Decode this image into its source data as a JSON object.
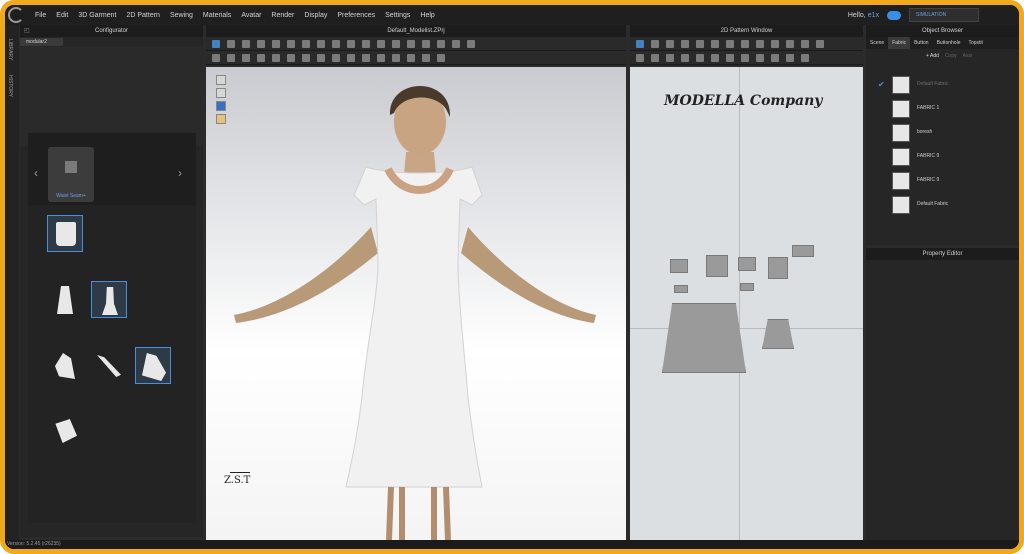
{
  "menubar": {
    "items": [
      "File",
      "Edit",
      "3D Garment",
      "2D Pattern",
      "Sewing",
      "Materials",
      "Avatar",
      "Render",
      "Display",
      "Preferences",
      "Settings",
      "Help"
    ],
    "greeting_prefix": "Hello,",
    "username": "e1x",
    "mode": "SIMULATION"
  },
  "left_strip": {
    "labels": [
      "LIBRARY",
      "HISTORY"
    ]
  },
  "configurator": {
    "title": "Configurator",
    "tab": "modular2",
    "block_label": "Waist Seam+"
  },
  "viewport": {
    "title": "Default_Modelist.ZPrj",
    "watermark": "Z.S.T"
  },
  "pattern_window": {
    "title": "2D Pattern Window",
    "company": "MODELLA Company"
  },
  "object_browser": {
    "title": "Object Browser",
    "tabs": [
      "Scene",
      "Fabric",
      "Button",
      "Buttonhole",
      "Topstit"
    ],
    "actions": {
      "add": "+ Add",
      "copy": "Copy",
      "assign": "Assi"
    },
    "fabrics": [
      {
        "name": "Default Fabric",
        "muted": true,
        "checked": true
      },
      {
        "name": "FABRIC 1",
        "muted": false,
        "checked": false
      },
      {
        "name": "boresh",
        "muted": false,
        "checked": false
      },
      {
        "name": "FABRIC 9",
        "muted": false,
        "checked": false
      },
      {
        "name": "FABRIC 9",
        "muted": false,
        "checked": false
      },
      {
        "name": "Default Fabric",
        "muted": false,
        "checked": false
      }
    ]
  },
  "property_editor": {
    "title": "Property Editor"
  },
  "status": {
    "version": "Version: 5.2.45    (r26235)"
  }
}
